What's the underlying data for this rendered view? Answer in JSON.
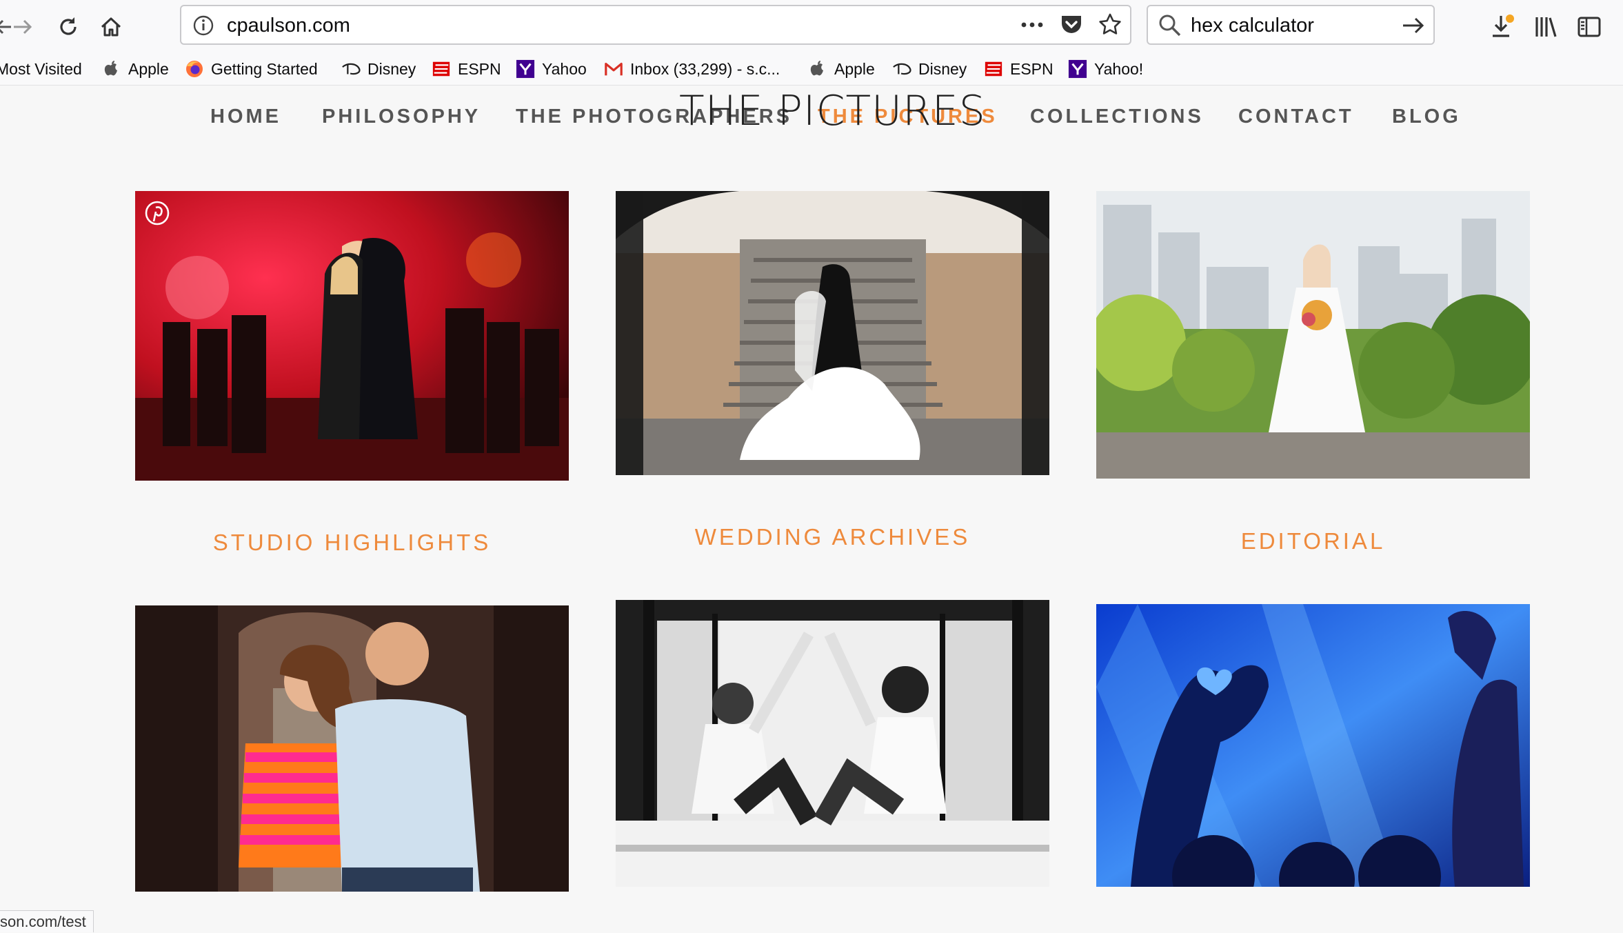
{
  "browser": {
    "url": "cpaulson.com",
    "search_query": "hex calculator",
    "bookmarks": [
      {
        "label": "Most Visited",
        "icon": "gear-icon"
      },
      {
        "label": "Apple",
        "icon": "apple-icon"
      },
      {
        "label": "Getting Started",
        "icon": "firefox-icon"
      },
      {
        "label": "Disney",
        "icon": "disney-icon"
      },
      {
        "label": "ESPN",
        "icon": "espn-icon"
      },
      {
        "label": "Yahoo",
        "icon": "yahoo-icon"
      },
      {
        "label": "Inbox (33,299) - s.c...",
        "icon": "gmail-icon"
      },
      {
        "label": "Apple",
        "icon": "apple-icon"
      },
      {
        "label": "Disney",
        "icon": "disney-icon"
      },
      {
        "label": "ESPN",
        "icon": "espn-icon"
      },
      {
        "label": "Yahoo!",
        "icon": "yahoo-icon"
      }
    ],
    "status_url": "son.com/test"
  },
  "site": {
    "logo": "THE PICTURES",
    "nav": [
      {
        "label": "HOME"
      },
      {
        "label": "PHILOSOPHY"
      },
      {
        "label": "THE PHOTOGRAPHERS"
      },
      {
        "label": "THE PICTURES",
        "active": true
      },
      {
        "label": "COLLECTIONS"
      },
      {
        "label": "CONTACT"
      },
      {
        "label": "BLOG"
      }
    ],
    "gallery": [
      {
        "caption": "STUDIO HIGHLIGHTS"
      },
      {
        "caption": "WEDDING ARCHIVES"
      },
      {
        "caption": "EDITORIAL"
      }
    ],
    "colors": {
      "accent": "#ee8a3c",
      "nav_text": "#555555",
      "background": "#f7f7f7"
    }
  }
}
